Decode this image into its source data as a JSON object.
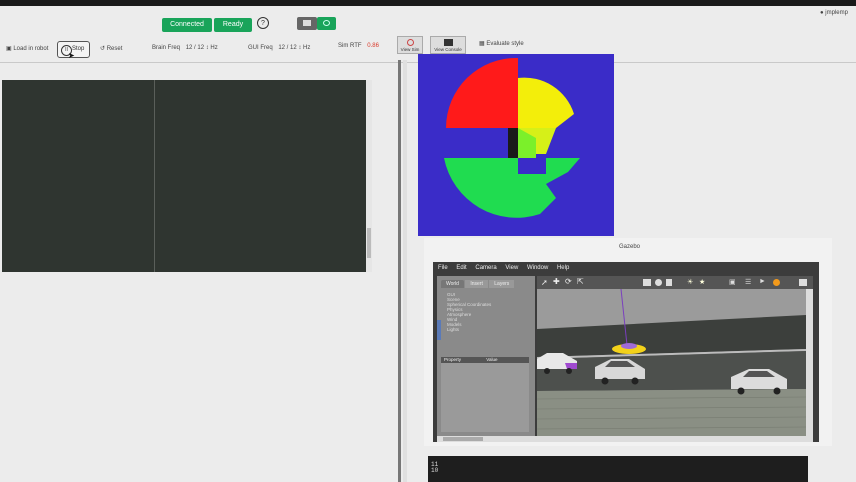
{
  "topbar": {
    "connected_label": "Connected",
    "ready_label": "Ready",
    "help_icon": "help-circle-icon",
    "user_label": "jmplemp"
  },
  "toolbar": {
    "load_robot_label": "Load in robot",
    "stop_label": "Stop",
    "reset_label": "Reset",
    "brain_freq_label": "Brain Freq",
    "brain_freq_value": "12 / 12 ↕ Hz",
    "gui_freq_label": "GUI Freq",
    "gui_freq_value": "12 / 12 ↕ Hz",
    "sim_rtf_label": "Sim RTF",
    "sim_rtf_value": "0.86",
    "view_sim_label": "View Sim",
    "view_console_label": "View Console",
    "evaluate_label": "Evaluate style"
  },
  "gazebo": {
    "title": "Gazebo",
    "menu": [
      "File",
      "Edit",
      "Camera",
      "View",
      "Window",
      "Help"
    ],
    "tabs": [
      "World",
      "Insert",
      "Layers"
    ],
    "tree_items": [
      "GUI",
      "Scene",
      "Spherical Coordinates",
      "Physics",
      "Atmosphere",
      "Wind",
      "Models",
      "Lights"
    ],
    "property_header": "Property",
    "value_header": "Value"
  },
  "console": {
    "lines": [
      "11",
      "10"
    ]
  },
  "colors": {
    "accent_green": "#19a45a",
    "rtf_red": "#d93a2b",
    "radar_background": "#3a2cc8"
  }
}
